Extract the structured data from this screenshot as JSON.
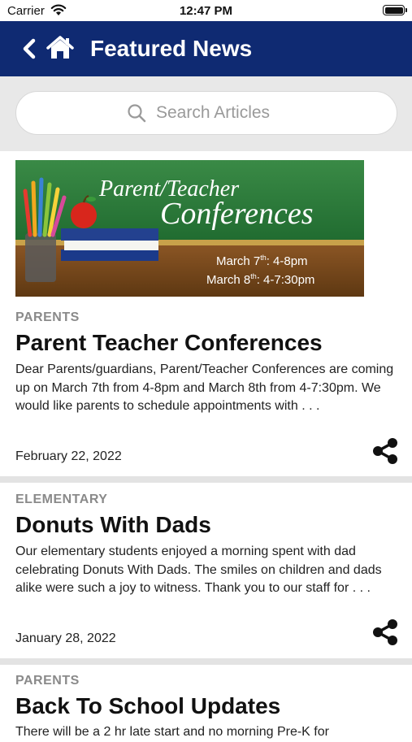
{
  "status_bar": {
    "carrier": "Carrier",
    "time": "12:47 PM"
  },
  "header": {
    "title": "Featured News"
  },
  "search": {
    "placeholder": "Search Articles"
  },
  "articles": [
    {
      "category": "PARENTS",
      "title": "Parent Teacher Conferences",
      "excerpt": "  Dear Parents/guardians, Parent/Teacher Conferences are coming up on March 7th from 4-8pm and March 8th from 4-7:30pm.  We would like parents to schedule appointments with . . .",
      "date": "February 22, 2022",
      "image": {
        "title_line1": "Parent/Teacher",
        "title_line2": "Conferences",
        "day1_date": "March 7",
        "day1_time": ": 4-8pm",
        "day2_date": "March 8",
        "day2_time": ": 4-7:30pm",
        "superscript": "th"
      }
    },
    {
      "category": "ELEMENTARY",
      "title": "Donuts With Dads",
      "excerpt": "Our elementary students enjoyed a morning spent with dad celebrating Donuts With Dads. The smiles on children and dads alike were such a joy to witness.  Thank you to our staff for . . .",
      "date": "January 28, 2022"
    },
    {
      "category": "PARENTS",
      "title": "Back To School Updates",
      "excerpt": "There will be a 2 hr late start and no morning Pre-K for"
    }
  ],
  "icons": {
    "back": "chevron-left-icon",
    "home": "home-icon",
    "search": "search-icon",
    "share": "share-icon"
  },
  "colors": {
    "header_bg": "#0f2a72",
    "search_bg": "#e8e8e8",
    "category_text": "#8a8a8a",
    "chalkboard": "#2e7d3c",
    "desk": "#7a4a1c"
  }
}
